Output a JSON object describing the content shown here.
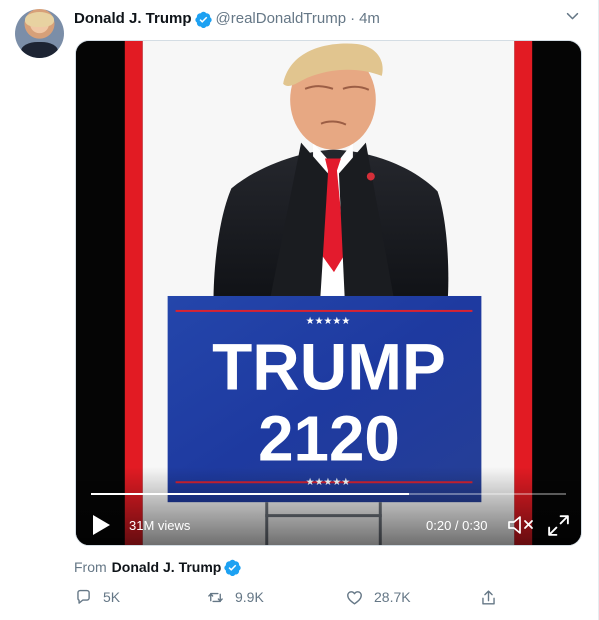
{
  "tweet": {
    "author": {
      "name": "Donald J. Trump",
      "handle": "@realDonaldTrump",
      "verified": true,
      "avatar": "avatar-photo"
    },
    "separator": "·",
    "timestamp": "4m",
    "media": {
      "type": "video",
      "sign_stars": "★★★★★",
      "sign_line_1": "TRUMP",
      "sign_line_2": "2120",
      "progress_fraction": 0.67,
      "views": "31M views",
      "duration": "0:20 / 0:30",
      "icons": {
        "play": "play-icon",
        "mute": "volume-muted-icon",
        "fullscreen": "expand-icon"
      }
    },
    "source_prefix": "From",
    "source_name": "Donald J. Trump",
    "actions": {
      "reply_count": "5K",
      "retweet_count": "9.9K",
      "like_count": "28.7K",
      "icons": {
        "reply": "reply-icon",
        "retweet": "retweet-icon",
        "like": "heart-icon",
        "share": "share-icon"
      }
    }
  },
  "colors": {
    "accent": "#1da1f2",
    "text_secondary": "#657786",
    "stripe_red": "#e21b23",
    "sign_blue": "#1e3aa0"
  }
}
